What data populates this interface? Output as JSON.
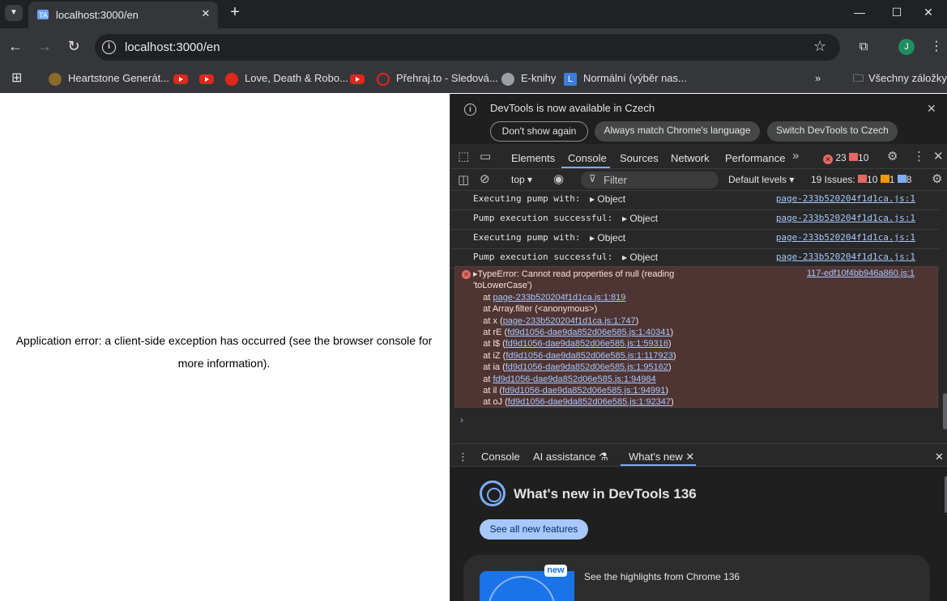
{
  "browser": {
    "tab_title": "localhost:3000/en",
    "url": "localhost:3000/en",
    "avatar_letter": "J",
    "bookmarks": [
      {
        "label": "Heartstone Generát..."
      },
      {
        "label": ""
      },
      {
        "label": ""
      },
      {
        "label": "Love, Death & Robo..."
      },
      {
        "label": ""
      },
      {
        "label": "Přehraj.to - Sledová..."
      },
      {
        "label": "E-knihy"
      },
      {
        "label": "Normální (výběr nas..."
      }
    ],
    "all_bookmarks": "Všechny záložky"
  },
  "page": {
    "error_line1": "Application error: a client-side exception has occurred (see the browser console for",
    "error_line2": "more information)."
  },
  "devtools": {
    "infobar": {
      "message": "DevTools is now available in Czech",
      "btn_dont_show": "Don't show again",
      "btn_match": "Always match Chrome's language",
      "btn_switch": "Switch DevTools to Czech"
    },
    "tabs": [
      "Elements",
      "Console",
      "Sources",
      "Network",
      "Performance"
    ],
    "error_count": "23",
    "warning_count": "10",
    "console_toolbar": {
      "context": "top",
      "filter_placeholder": "Filter",
      "levels": "Default levels",
      "issues_label": "19 Issues:",
      "issues_errors": "10",
      "issues_warnings": "1",
      "issues_info": "8"
    },
    "logs": [
      {
        "msg": "Executing pump with:",
        "obj": "Object",
        "src": "page-233b520204f1d1ca.js:1"
      },
      {
        "msg": "Pump execution successful:",
        "obj": "Object",
        "src": "page-233b520204f1d1ca.js:1"
      },
      {
        "msg": "Executing pump with:",
        "obj": "Object",
        "src": "page-233b520204f1d1ca.js:1"
      },
      {
        "msg": "Pump execution successful:",
        "obj": "Object",
        "src": "page-233b520204f1d1ca.js:1"
      }
    ],
    "error": {
      "line1": "TypeError: Cannot read properties of null (reading",
      "line2": "'toLowerCase')",
      "src": "117-edf10f4bb946a860.js:1",
      "stack": [
        {
          "pre": "    at ",
          "link": "page-233b520204f1d1ca.js:1:819",
          "post": ""
        },
        {
          "pre": "    at Array.filter (<anonymous>)",
          "link": "",
          "post": ""
        },
        {
          "pre": "    at x (",
          "link": "page-233b520204f1d1ca.js:1:747",
          "post": ")"
        },
        {
          "pre": "    at rE (",
          "link": "fd9d1056-dae9da852d06e585.js:1:40341",
          "post": ")"
        },
        {
          "pre": "    at l$ (",
          "link": "fd9d1056-dae9da852d06e585.js:1:59316",
          "post": ")"
        },
        {
          "pre": "    at iZ (",
          "link": "fd9d1056-dae9da852d06e585.js:1:117923",
          "post": ")"
        },
        {
          "pre": "    at ia (",
          "link": "fd9d1056-dae9da852d06e585.js:1:95162",
          "post": ")"
        },
        {
          "pre": "    at ",
          "link": "fd9d1056-dae9da852d06e585.js:1:94984",
          "post": ""
        },
        {
          "pre": "    at il (",
          "link": "fd9d1056-dae9da852d06e585.js:1:94991",
          "post": ")"
        },
        {
          "pre": "    at oJ (",
          "link": "fd9d1056-dae9da852d06e585.js:1:92347",
          "post": ")"
        }
      ]
    },
    "drawer": {
      "tabs": [
        "Console",
        "AI assistance",
        "What's new"
      ],
      "title": "What's new in DevTools 136",
      "see_all": "See all new features",
      "card_badge": "new",
      "card_text": "See the highlights from Chrome 136"
    }
  }
}
